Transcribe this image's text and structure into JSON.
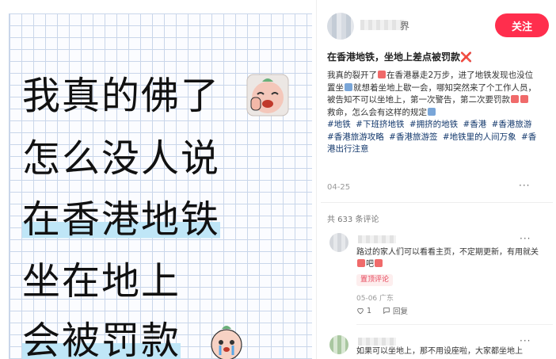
{
  "image_card": {
    "lines": [
      "我真的佛了",
      "怎么没人说",
      "在香港地铁",
      "坐在地上",
      "会被罚款"
    ]
  },
  "author": {
    "name_visible": "界",
    "follow_label": "关注"
  },
  "post": {
    "title": "在香港地铁，坐地上差点被罚款❌",
    "body_1": "我真的裂开了",
    "body_2": "在香港暴走2万步，进了地铁发现也没位置坐",
    "body_3": "就想着坐地上歇一会，哪知突然来了个工作人员，被告知不可以坐地上，第一次警告，第二次要罚款",
    "body_4": "救命，怎么会有这样的规定",
    "tags": [
      "#地铁",
      "#下班挤地铁",
      "#拥挤的地铁",
      "#香港",
      "#香港旅游",
      "#香港旅游攻略",
      "#香港旅游签",
      "#地铁里的人间万象",
      "#香港出行注意"
    ],
    "date": "04-25"
  },
  "comments": {
    "count_label": "共 633 条评论",
    "items": [
      {
        "text": "路过的家人们可以看看主页，不定期更新，有用就关",
        "text_tail": "吧",
        "badge": "置顶评论",
        "meta": "05-06 广东",
        "likes": "1",
        "reply_label": "回复"
      },
      {
        "text": "如果可以坐地上，那不用设座啦，大家都坐地上"
      }
    ]
  },
  "icons": {
    "more": "more-dots-icon",
    "like": "heart-icon",
    "reply": "comment-icon"
  },
  "colors": {
    "accent": "#ff2e4d",
    "tag": "#13386c",
    "highlight": "#bfe6f7"
  }
}
